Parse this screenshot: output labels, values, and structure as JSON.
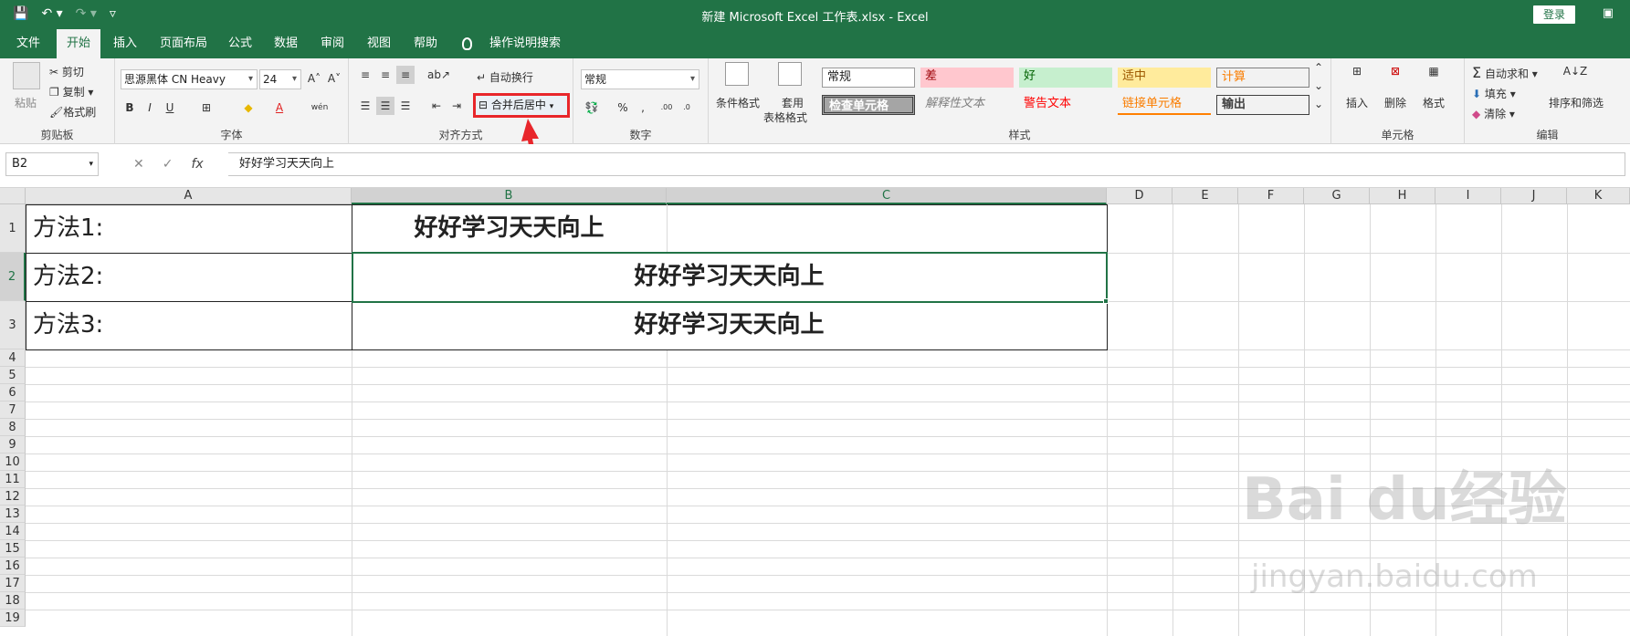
{
  "titlebar": {
    "title": "新建 Microsoft Excel 工作表.xlsx  -  Excel",
    "login": "登录",
    "save_icon": "save-icon",
    "undo_icon": "undo-icon",
    "redo_icon": "redo-icon"
  },
  "tabs": [
    "文件",
    "开始",
    "插入",
    "页面布局",
    "公式",
    "数据",
    "审阅",
    "视图",
    "帮助",
    "操作说明搜索"
  ],
  "ribbon": {
    "clipboard": {
      "paste": "粘贴",
      "cut": "剪切",
      "copy": "复制",
      "format_painter": "格式刷",
      "label": "剪贴板"
    },
    "font": {
      "name": "思源黑体 CN Heavy",
      "size": "24",
      "bold": "B",
      "italic": "I",
      "underline": "U",
      "wen": "wén",
      "label": "字体"
    },
    "alignment": {
      "wrap": "自动换行",
      "merge": "合并后居中",
      "label": "对齐方式"
    },
    "number": {
      "format": "常规",
      "percent": "%",
      "comma": ",",
      "label": "数字"
    },
    "styles": {
      "conditional": "条件格式",
      "table_format_1": "套用",
      "table_format_2": "表格格式",
      "cells": [
        "常规",
        "差",
        "好",
        "适中",
        "计算",
        "检查单元格",
        "解释性文本",
        "警告文本",
        "链接单元格",
        "输出"
      ],
      "label": "样式"
    },
    "cells": {
      "insert": "插入",
      "delete": "删除",
      "format": "格式",
      "label": "单元格"
    },
    "editing": {
      "autosum": "自动求和",
      "fill": "填充",
      "clear": "清除",
      "sort": "排序和筛选",
      "label": "编辑"
    }
  },
  "formula_bar": {
    "name_box": "B2",
    "formula": "好好学习天天向上",
    "fx": "fx"
  },
  "columns": [
    "A",
    "B",
    "C",
    "D",
    "E",
    "F",
    "G",
    "H",
    "I",
    "J",
    "K"
  ],
  "rows": [
    "1",
    "2",
    "3",
    "4",
    "5",
    "6",
    "7",
    "8",
    "9",
    "10",
    "11",
    "12",
    "13",
    "14",
    "15",
    "16",
    "17",
    "18",
    "19"
  ],
  "cells": {
    "a1": "方法1:",
    "a2": "方法2:",
    "a3": "方法3:",
    "b1": "好好学习天天向上",
    "b2": "好好学习天天向上",
    "b3": "好好学习天天向上"
  },
  "watermark": {
    "logo": "Bai du经验",
    "url": "jingyan.baidu.com"
  },
  "colors": {
    "excel_green": "#217346",
    "highlight_red": "#e8262b"
  }
}
